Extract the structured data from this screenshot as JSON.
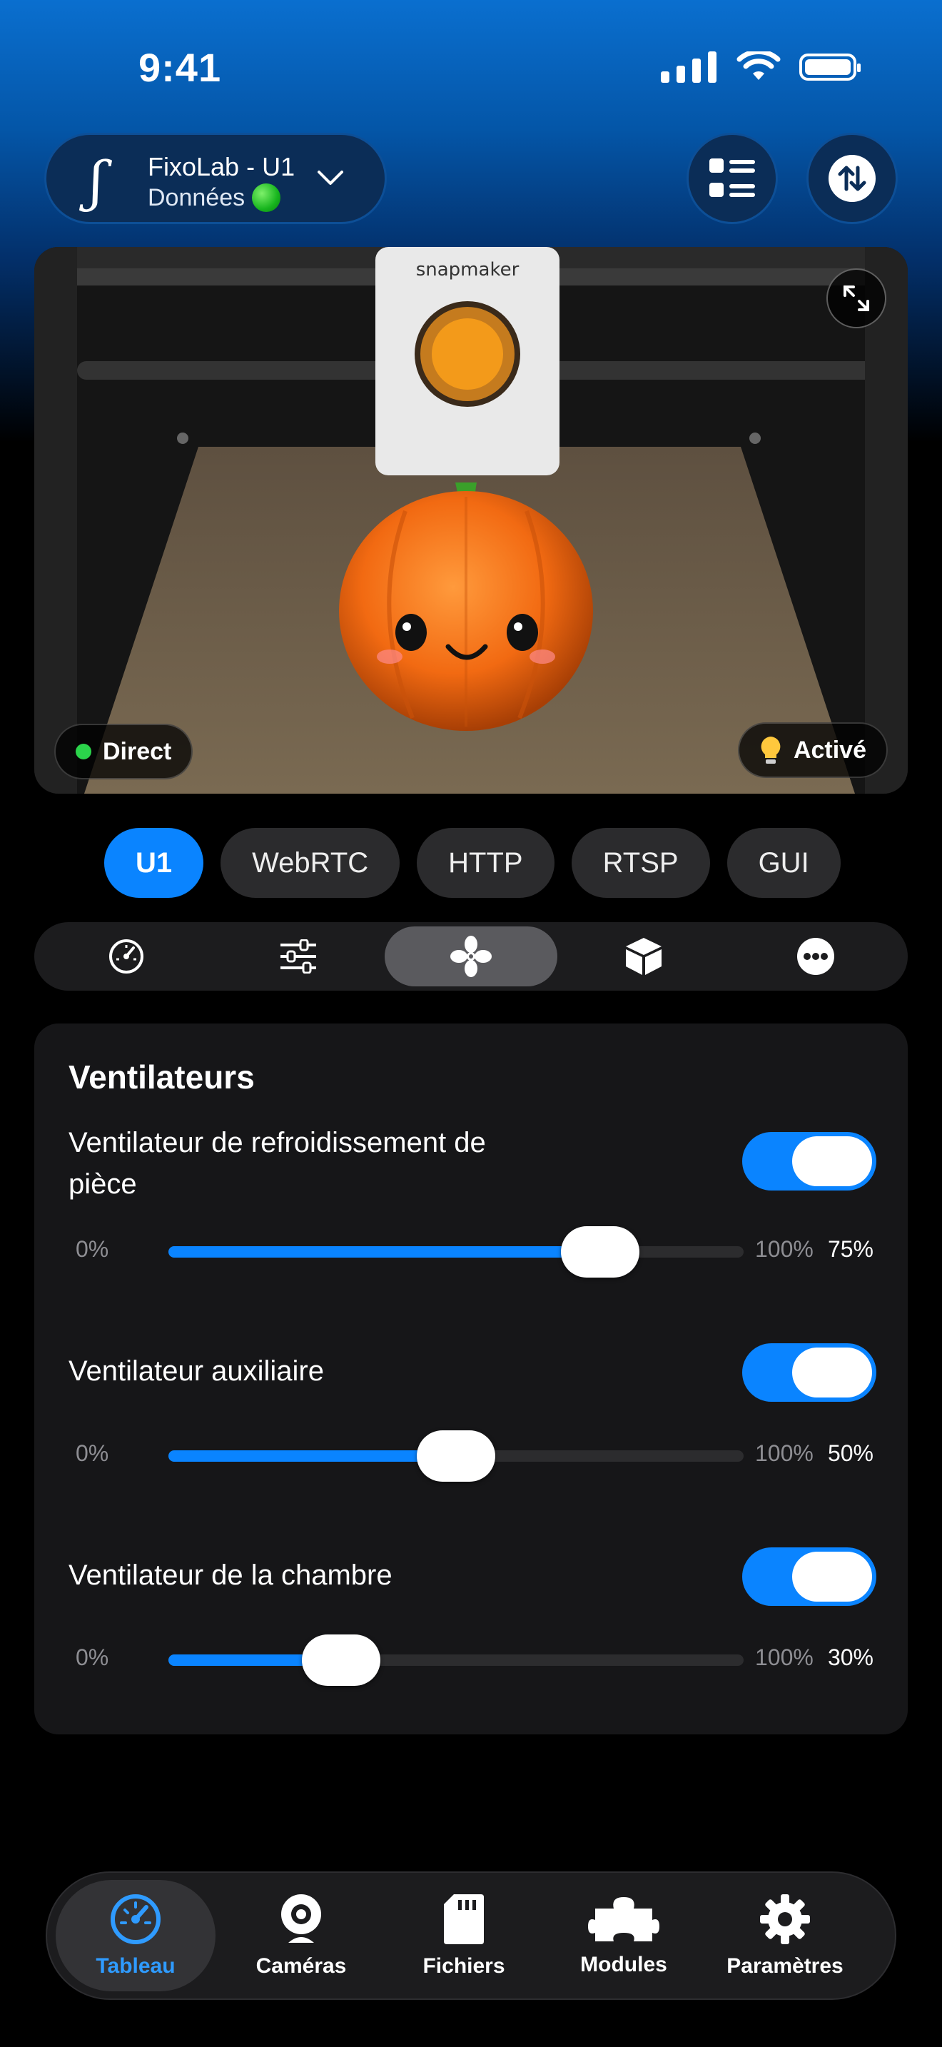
{
  "status_bar": {
    "time": "9:41"
  },
  "header": {
    "logo": "ʃ",
    "device_name": "FixoLab - U1",
    "device_subtitle": "Données",
    "list_icon": "list-icon",
    "sync_icon": "sync-arrows-icon"
  },
  "camera": {
    "live_label": "Direct",
    "light_label": "Activé",
    "brand": "snapmaker"
  },
  "sources": [
    "U1",
    "WebRTC",
    "HTTP",
    "RTSP",
    "GUI"
  ],
  "active_source": "U1",
  "segments": [
    "dashboard-icon",
    "sliders-icon",
    "fan-icon",
    "box-icon",
    "more-icon"
  ],
  "active_segment": "fan-icon",
  "fans_card": {
    "title": "Ventilateurs",
    "fans": [
      {
        "label": "Ventilateur de refroidissement de pièce",
        "enabled": true,
        "min": "0%",
        "max": "100%",
        "value_label": "75%",
        "value": 0.75
      },
      {
        "label": "Ventilateur auxiliaire",
        "enabled": true,
        "min": "0%",
        "max": "100%",
        "value_label": "50%",
        "value": 0.5
      },
      {
        "label": "Ventilateur de la chambre",
        "enabled": true,
        "min": "0%",
        "max": "100%",
        "value_label": "30%",
        "value": 0.3
      }
    ]
  },
  "tabbar": {
    "items": [
      {
        "label": "Tableau",
        "icon": "gauge-icon",
        "active": true
      },
      {
        "label": "Caméras",
        "icon": "webcam-icon",
        "active": false
      },
      {
        "label": "Fichiers",
        "icon": "sd-card-icon",
        "active": false
      },
      {
        "label": "Modules",
        "icon": "puzzle-icon",
        "active": false
      },
      {
        "label": "Paramètres",
        "icon": "gear-icon",
        "active": false
      }
    ]
  },
  "colors": {
    "accent": "#0a84ff",
    "card": "#161618",
    "chip": "#2b2b2d"
  }
}
